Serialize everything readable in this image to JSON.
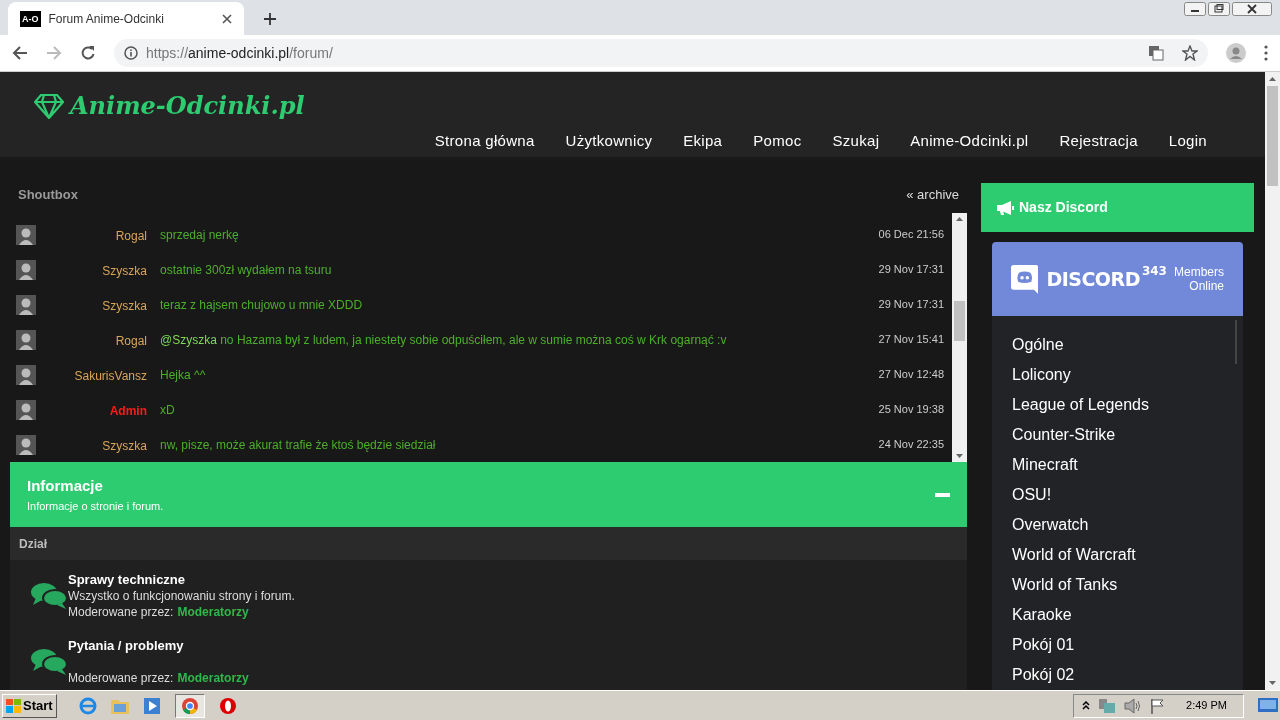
{
  "browser": {
    "tab_favicon": "A-O",
    "tab_title": "Forum Anime-Odcinki",
    "url_scheme": "https://",
    "url_host": "anime-odcinki.pl",
    "url_path": "/forum/"
  },
  "site": {
    "logo": "Anime-Odcinki.pl",
    "nav": [
      "Strona główna",
      "Użytkownicy",
      "Ekipa",
      "Pomoc",
      "Szukaj",
      "Anime-Odcinki.pl",
      "Rejestracja",
      "Login"
    ]
  },
  "shoutbox": {
    "title": "Shoutbox",
    "archive_link": "« archive",
    "messages": [
      {
        "user": "Rogal",
        "color": "#d9a55b",
        "admin": false,
        "text": "sprzedaj nerkę",
        "time": "06 Dec 21:56"
      },
      {
        "user": "Szyszka",
        "color": "#d9a55b",
        "admin": false,
        "text": "ostatnie 300zł wydałem na tsuru",
        "time": "29 Nov 17:31"
      },
      {
        "user": "Szyszka",
        "color": "#d9a55b",
        "admin": false,
        "text": "teraz z hajsem chujowo u mnie XDDD",
        "time": "29 Nov 17:31"
      },
      {
        "user": "Rogal",
        "color": "#d9a55b",
        "admin": false,
        "mention": "@Szyszka",
        "text": "no Hazama był z ludem, ja niestety sobie odpuściłem, ale w sumie można coś w Krk ogarnąć :v",
        "time": "27 Nov 15:41"
      },
      {
        "user": "SakurisVansz",
        "color": "#d9a55b",
        "admin": false,
        "text": "Hejka ^^",
        "time": "27 Nov 12:48"
      },
      {
        "user": "Admin",
        "color": "#ff1a1a",
        "admin": true,
        "text": "xD",
        "time": "25 Nov 19:38"
      },
      {
        "user": "Szyszka",
        "color": "#d9a55b",
        "admin": false,
        "text": "nw, pisze, może akurat trafie że ktoś będzie siedział",
        "time": "24 Nov 22:35"
      }
    ]
  },
  "category": {
    "title": "Informacje",
    "subtitle": "Informacje o stronie i forum.",
    "expanded": true,
    "column_header": "Dział",
    "forums": [
      {
        "title": "Sprawy techniczne",
        "description": "Wszystko o funkcjonowaniu strony i forum.",
        "moderated_label": "Moderowane przez:",
        "moderators": "Moderatorzy"
      },
      {
        "title": "Pytania / problemy",
        "moderated_label": "Moderowane przez:",
        "moderators": "Moderatorzy"
      }
    ]
  },
  "discord": {
    "title": "Nasz Discord",
    "brand": "DISCORD",
    "member_count": "343",
    "members_label": "Members Online",
    "channels": [
      "Ogólne",
      "Lolicony",
      "League of Legends",
      "Counter-Strike",
      "Minecraft",
      "OSU!",
      "Overwatch",
      "World of Warcraft",
      "World of Tanks",
      "Karaoke",
      "Pokój 01",
      "Pokój 02"
    ]
  },
  "taskbar": {
    "start": "Start",
    "clock": "2:49 PM"
  }
}
